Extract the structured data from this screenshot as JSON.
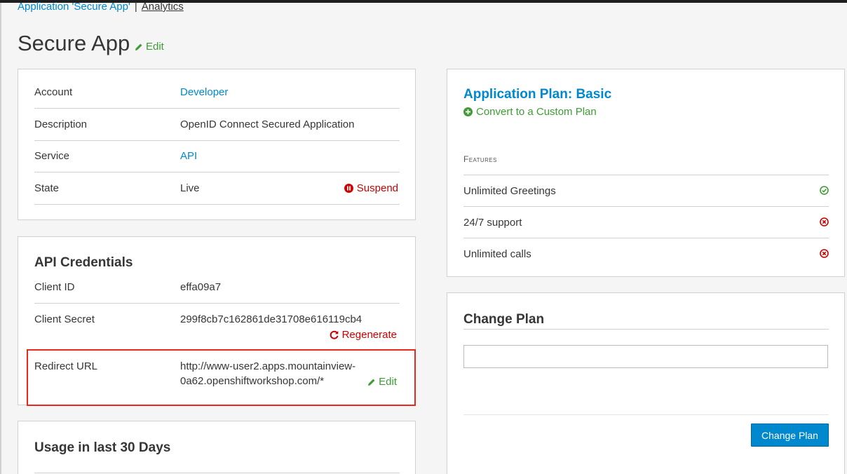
{
  "breadcrumb": {
    "application_link": "Application 'Secure App'",
    "separator": "|",
    "analytics_link": "Analytics"
  },
  "page": {
    "title": "Secure App",
    "edit_label": "Edit"
  },
  "details": {
    "rows": [
      {
        "label": "Account",
        "value": "Developer"
      },
      {
        "label": "Description",
        "value": "OpenID Connect Secured Application"
      },
      {
        "label": "Service",
        "value": "API"
      },
      {
        "label": "State",
        "value": "Live"
      }
    ],
    "suspend_label": "Suspend"
  },
  "credentials": {
    "heading": "API Credentials",
    "client_id_label": "Client ID",
    "client_id_value": "effa09a7",
    "client_secret_label": "Client Secret",
    "client_secret_value": "299f8cb7c162861de31708e616119cb4",
    "regenerate_label": "Regenerate",
    "redirect_label": "Redirect URL",
    "redirect_line1": "http://www-user2.apps.mountainview-",
    "redirect_line2": "0a62.openshiftworkshop.com/*",
    "redirect_edit_label": "Edit"
  },
  "usage": {
    "heading": "Usage in last 30 Days"
  },
  "plan": {
    "title": "Application Plan: Basic",
    "convert_label": "Convert to a Custom Plan",
    "features_label": "Features",
    "features": [
      {
        "name": "Unlimited Greetings",
        "enabled": true
      },
      {
        "name": "24/7 support",
        "enabled": false
      },
      {
        "name": "Unlimited calls",
        "enabled": false
      }
    ]
  },
  "change_plan": {
    "heading": "Change Plan",
    "select_value": "",
    "button_label": "Change Plan"
  },
  "colors": {
    "link": "#0088ce",
    "success": "#3f9c35",
    "danger": "#cc0000",
    "highlight": "#e8291c"
  }
}
